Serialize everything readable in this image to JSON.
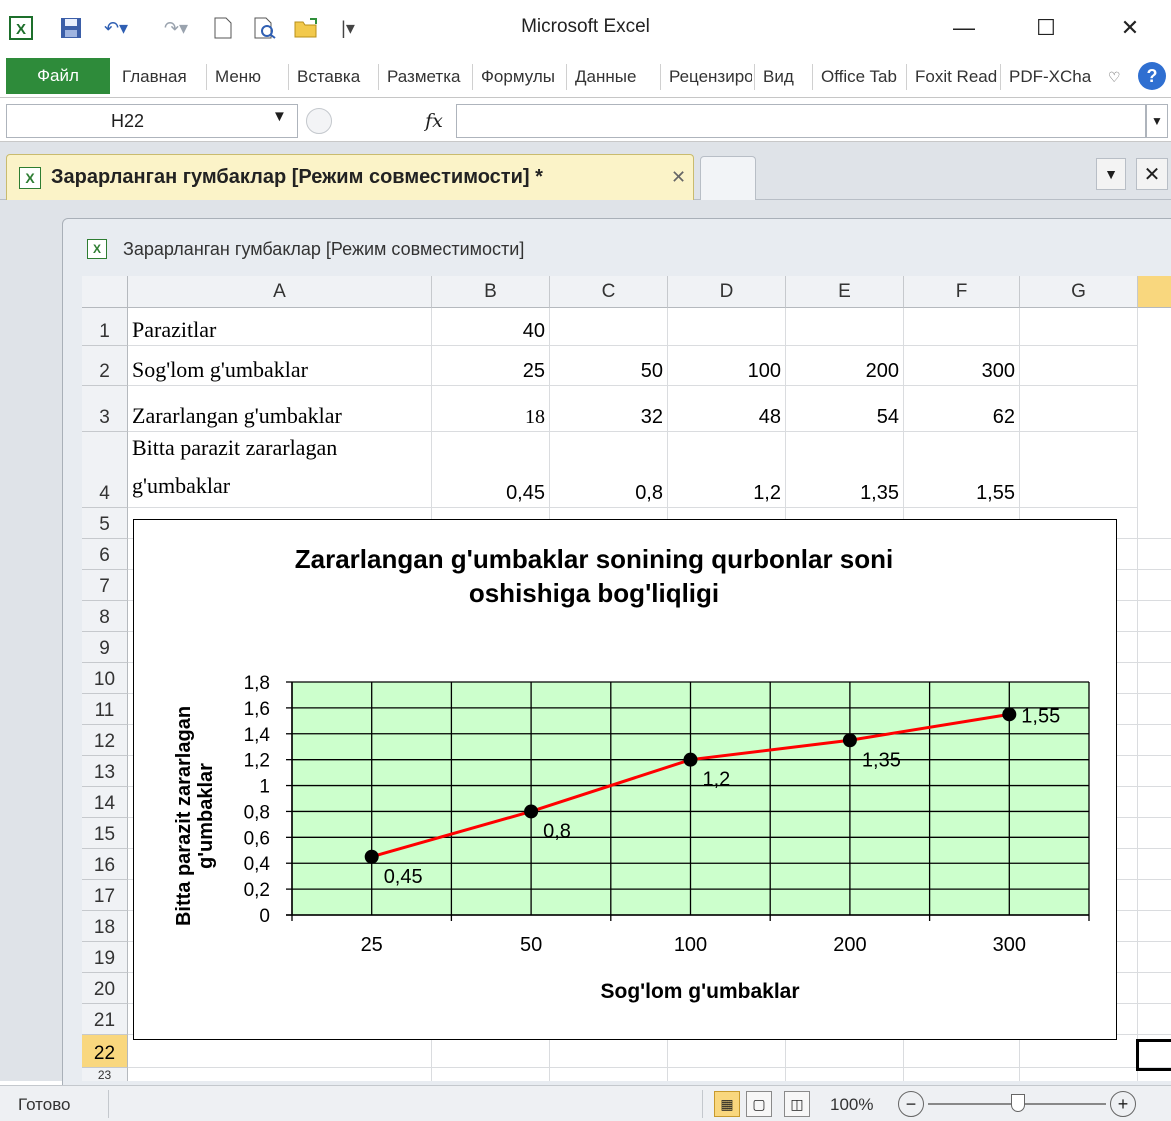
{
  "app": {
    "title": "Microsoft Excel",
    "window_controls": {
      "minimize": "—",
      "maximize": "☐",
      "close": "✕"
    }
  },
  "quick_access": {
    "icons": [
      "excel-icon",
      "save-icon",
      "undo-icon",
      "redo-icon",
      "new-icon",
      "print-preview-icon",
      "open-icon",
      "customize-icon"
    ]
  },
  "ribbon": {
    "file_tab": "Файл",
    "tabs": [
      "Главная",
      "Меню",
      "Вставка",
      "Разметка",
      "Формулы",
      "Данные",
      "Рецензирование",
      "Вид",
      "Office Tab",
      "Foxit Reader",
      "PDF-XChange"
    ]
  },
  "formula_bar": {
    "name_box": "H22",
    "fx_label": "fx",
    "formula": ""
  },
  "workbook_tab": {
    "label": "Зарарланган гумбаклар  [Режим совместимости] *",
    "close": "✕"
  },
  "inner_window": {
    "title": "Зарарланган гумбаклар  [Режим совместимости]"
  },
  "grid": {
    "columns": [
      "A",
      "B",
      "C",
      "D",
      "E",
      "F",
      "G"
    ],
    "rows": [
      "1",
      "2",
      "3",
      "4",
      "5",
      "6",
      "7",
      "8",
      "9",
      "10",
      "11",
      "12",
      "13",
      "14",
      "15",
      "16",
      "17",
      "18",
      "19",
      "20",
      "21",
      "22",
      "23"
    ],
    "selected_row": "22",
    "cells": {
      "A1": "Parazitlar",
      "B1": "40",
      "A2": "Sog'lom g'umbaklar",
      "B2": "25",
      "C2": "50",
      "D2": "100",
      "E2": "200",
      "F2": "300",
      "A3": "Zararlangan g'umbaklar",
      "B3": "18",
      "C3": "32",
      "D3": "48",
      "E3": "54",
      "F3": "62",
      "A4_line1": "Bitta parazit zararlagan",
      "A4_line2": "g'umbaklar",
      "B4": "0,45",
      "C4": "0,8",
      "D4": "1,2",
      "E4": "1,35",
      "F4": "1,55"
    }
  },
  "chart_data": {
    "type": "line",
    "title_line1": "Zararlangan g'umbaklar sonining qurbonlar soni",
    "title_line2": "oshishiga bog'liqligi",
    "xlabel": "Sog'lom g'umbaklar",
    "ylabel_line1": "Bitta parazit zararlagan",
    "ylabel_line2": "g'umbaklar",
    "categories": [
      "25",
      "50",
      "100",
      "200",
      "300"
    ],
    "series": [
      {
        "values": [
          0.45,
          0.8,
          1.2,
          1.35,
          1.55
        ],
        "data_labels": [
          "0,45",
          "0,8",
          "1,2",
          "1,35",
          "1,55"
        ],
        "line_color": "#ff0000",
        "marker_color": "#000000"
      }
    ],
    "ylim": [
      0,
      1.8
    ],
    "yticks": [
      "0",
      "0,2",
      "0,4",
      "0,6",
      "0,8",
      "1",
      "1,2",
      "1,4",
      "1,6",
      "1,8"
    ],
    "plot_background": "#ccffcc",
    "grid": true
  },
  "status_bar": {
    "status": "Готово",
    "zoom": "100%",
    "zoom_out": "−",
    "zoom_in": "+"
  },
  "colors": {
    "file_tab": "#2e8b3a",
    "selected_header": "#f9d77e",
    "workbook_tab": "#fbf3c8"
  }
}
